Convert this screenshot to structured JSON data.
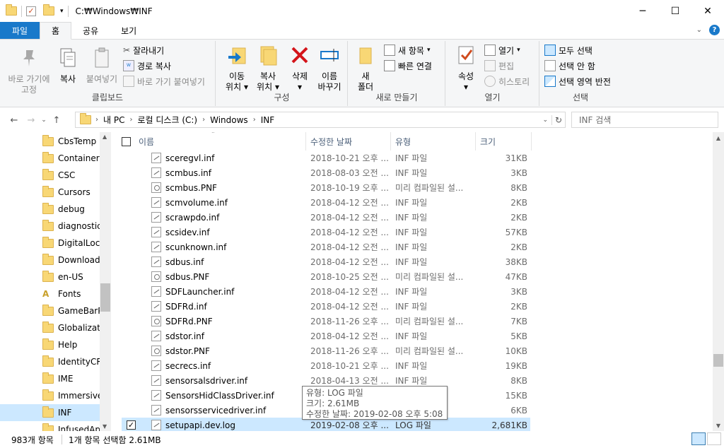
{
  "window": {
    "title": "C:₩Windows₩INF"
  },
  "win_controls": {
    "minimize": "─",
    "maximize": "☐",
    "close": "✕"
  },
  "tabs": {
    "file": "파일",
    "home": "홈",
    "share": "공유",
    "view": "보기"
  },
  "ribbon": {
    "clipboard": {
      "label": "클립보드",
      "pin": "바로 가기에\n고정",
      "pin_l1": "바로 가기에",
      "pin_l2": "고정",
      "copy": "복사",
      "paste": "붙여넣기",
      "cut": "잘라내기",
      "copy_path": "경로 복사",
      "paste_shortcut": "바로 가기 붙여넣기"
    },
    "organize": {
      "label": "구성",
      "move_l1": "이동",
      "move_l2": "위치",
      "copy_l1": "복사",
      "copy_l2": "위치",
      "delete": "삭제",
      "rename_l1": "이름",
      "rename_l2": "바꾸기"
    },
    "new": {
      "label": "새로 만들기",
      "folder_l1": "새",
      "folder_l2": "폴더",
      "new_item": "새 항목",
      "easy_access": "빠른 연결"
    },
    "open": {
      "label": "열기",
      "properties": "속성",
      "open": "열기",
      "edit": "편집",
      "history": "히스토리"
    },
    "select": {
      "label": "선택",
      "select_all": "모두 선택",
      "select_none": "선택 안 함",
      "invert": "선택 영역 반전"
    }
  },
  "address": {
    "crumbs": [
      "내 PC",
      "로컬 디스크 (C:)",
      "Windows",
      "INF"
    ],
    "search_placeholder": "INF 검색"
  },
  "nav": {
    "items": [
      "CbsTemp",
      "Containers",
      "CSC",
      "Cursors",
      "debug",
      "diagnostics",
      "DigitalLocker",
      "Downloaded",
      "en-US",
      "Fonts",
      "GameBarPre",
      "Globalization",
      "Help",
      "IdentityCRL",
      "IME",
      "ImmersiveC",
      "INF",
      "InfusedApp"
    ]
  },
  "columns": {
    "name": "이름",
    "date": "수정한 날짜",
    "type": "유형",
    "size": "크기"
  },
  "files": [
    {
      "name": "sceregvl.inf",
      "date": "2018-10-21 오후 ...",
      "type": "INF 파일",
      "size": "31KB",
      "kind": "inf"
    },
    {
      "name": "scmbus.inf",
      "date": "2018-08-03 오전 ...",
      "type": "INF 파일",
      "size": "3KB",
      "kind": "inf"
    },
    {
      "name": "scmbus.PNF",
      "date": "2018-10-19 오후 ...",
      "type": "미리 컴파일된 설...",
      "size": "8KB",
      "kind": "png"
    },
    {
      "name": "scmvolume.inf",
      "date": "2018-04-12 오전 ...",
      "type": "INF 파일",
      "size": "2KB",
      "kind": "inf"
    },
    {
      "name": "scrawpdo.inf",
      "date": "2018-04-12 오전 ...",
      "type": "INF 파일",
      "size": "2KB",
      "kind": "inf"
    },
    {
      "name": "scsidev.inf",
      "date": "2018-04-12 오전 ...",
      "type": "INF 파일",
      "size": "57KB",
      "kind": "inf"
    },
    {
      "name": "scunknown.inf",
      "date": "2018-04-12 오전 ...",
      "type": "INF 파일",
      "size": "2KB",
      "kind": "inf"
    },
    {
      "name": "sdbus.inf",
      "date": "2018-04-12 오전 ...",
      "type": "INF 파일",
      "size": "38KB",
      "kind": "inf"
    },
    {
      "name": "sdbus.PNF",
      "date": "2018-10-25 오전 ...",
      "type": "미리 컴파일된 설...",
      "size": "47KB",
      "kind": "png"
    },
    {
      "name": "SDFLauncher.inf",
      "date": "2018-04-12 오전 ...",
      "type": "INF 파일",
      "size": "3KB",
      "kind": "inf"
    },
    {
      "name": "SDFRd.inf",
      "date": "2018-04-12 오전 ...",
      "type": "INF 파일",
      "size": "2KB",
      "kind": "inf"
    },
    {
      "name": "SDFRd.PNF",
      "date": "2018-11-26 오후 ...",
      "type": "미리 컴파일된 설...",
      "size": "7KB",
      "kind": "png"
    },
    {
      "name": "sdstor.inf",
      "date": "2018-04-12 오전 ...",
      "type": "INF 파일",
      "size": "5KB",
      "kind": "inf"
    },
    {
      "name": "sdstor.PNF",
      "date": "2018-11-26 오후 ...",
      "type": "미리 컴파일된 설...",
      "size": "10KB",
      "kind": "png"
    },
    {
      "name": "secrecs.inf",
      "date": "2018-10-21 오후 ...",
      "type": "INF 파일",
      "size": "19KB",
      "kind": "inf"
    },
    {
      "name": "sensorsalsdriver.inf",
      "date": "2018-04-13 오전 ...",
      "type": "INF 파일",
      "size": "8KB",
      "kind": "inf"
    },
    {
      "name": "SensorsHidClassDriver.inf",
      "date": "",
      "type": "",
      "size": "15KB",
      "kind": "inf"
    },
    {
      "name": "sensorsservicedriver.inf",
      "date": "",
      "type": "",
      "size": "6KB",
      "kind": "inf"
    },
    {
      "name": "setupapi.dev.log",
      "date": "2019-02-08 오후 ...",
      "type": "LOG 파일",
      "size": "2,681KB",
      "kind": "inf",
      "selected": true
    }
  ],
  "tooltip": {
    "type": "유형: LOG 파일",
    "size": "크기: 2.61MB",
    "modified": "수정한 날짜: 2019-02-08 오후 5:08"
  },
  "status": {
    "count": "983개 항목",
    "selection": "1개 항목 선택함 2.61MB"
  }
}
